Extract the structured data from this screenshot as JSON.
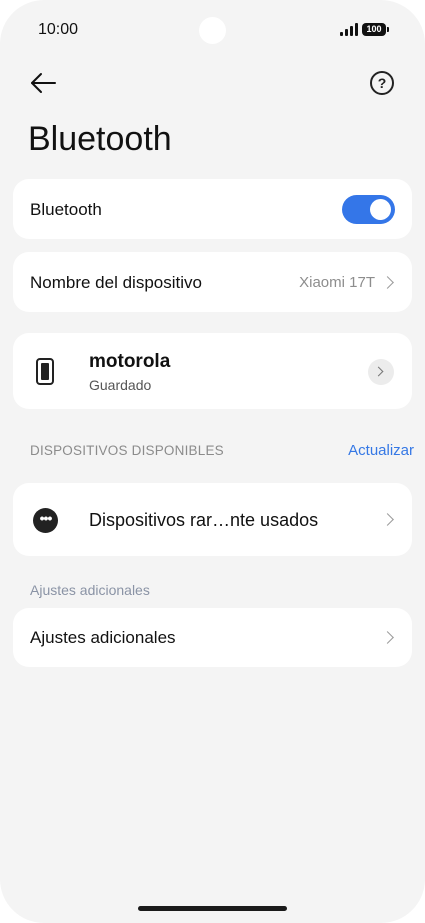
{
  "status_bar": {
    "time": "10:00",
    "battery": "100"
  },
  "header": {
    "title": "Bluetooth"
  },
  "bluetooth_toggle": {
    "label": "Bluetooth",
    "enabled": true,
    "color": "#3476e8"
  },
  "device_name_row": {
    "label": "Nombre del dispositivo",
    "value": "Xiaomi 17T"
  },
  "saved_device": {
    "name": "motorola",
    "status": "Guardado"
  },
  "available_section": {
    "header": "DISPOSITIVOS DISPONIBLES",
    "action": "Actualizar",
    "action_color": "#3578e5"
  },
  "rare_devices": {
    "label": "Dispositivos rar…nte usados"
  },
  "additional": {
    "section_label": "Ajustes adicionales",
    "row_label": "Ajustes adicionales"
  },
  "icons": {
    "back": "arrow-left-icon",
    "help": "question-circle-icon",
    "device": "smartphone-icon",
    "more": "more-dots-icon",
    "chevron": "chevron-right-icon"
  }
}
